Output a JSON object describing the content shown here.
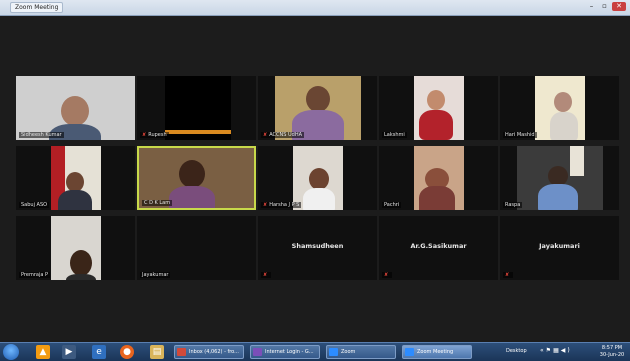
{
  "window": {
    "title": "Zoom Meeting"
  },
  "participants": [
    {
      "name": "Sidheesh Kumar",
      "muted": false,
      "video": true
    },
    {
      "name": "Rupesh",
      "muted": true,
      "video": true
    },
    {
      "name": "ACCNS UdHA",
      "muted": true,
      "video": true
    },
    {
      "name": "Lakshmi",
      "muted": false,
      "video": true
    },
    {
      "name": "Hari Mashid",
      "muted": false,
      "video": true
    },
    {
      "name": "Sabuj ASO",
      "muted": false,
      "video": true
    },
    {
      "name": "C D K Lam",
      "muted": false,
      "video": true,
      "active": true
    },
    {
      "name": "Harsha J P S",
      "muted": true,
      "video": true
    },
    {
      "name": "Pachri",
      "muted": false,
      "video": true
    },
    {
      "name": "Raspa",
      "muted": false,
      "video": true
    },
    {
      "name": "Premraja P",
      "muted": false,
      "video": true
    },
    {
      "name": "Jayakumar",
      "muted": false,
      "video": false
    },
    {
      "name": "Shamsudheen",
      "muted": true,
      "video": false,
      "label": "Shamsudheen"
    },
    {
      "name": "Ar.G.Sasikumar",
      "muted": true,
      "video": false,
      "label": "Ar.G.Sasikumar"
    },
    {
      "name": "Jayakumari",
      "muted": true,
      "video": false,
      "label": "Jayakumari"
    }
  ],
  "taskbar": {
    "tasks": [
      {
        "label": "Inbox (4,062) - fro...",
        "icon_color": "#d24a3a"
      },
      {
        "label": "Internet Login - G...",
        "icon_color": "#7b4fb8"
      },
      {
        "label": "Zoom",
        "icon_color": "#2d8cff"
      },
      {
        "label": "Zoom Meeting",
        "icon_color": "#2d8cff"
      }
    ],
    "desktop_label": "Desktop",
    "time": "8:57 PM",
    "date": "30-Jun-20"
  }
}
